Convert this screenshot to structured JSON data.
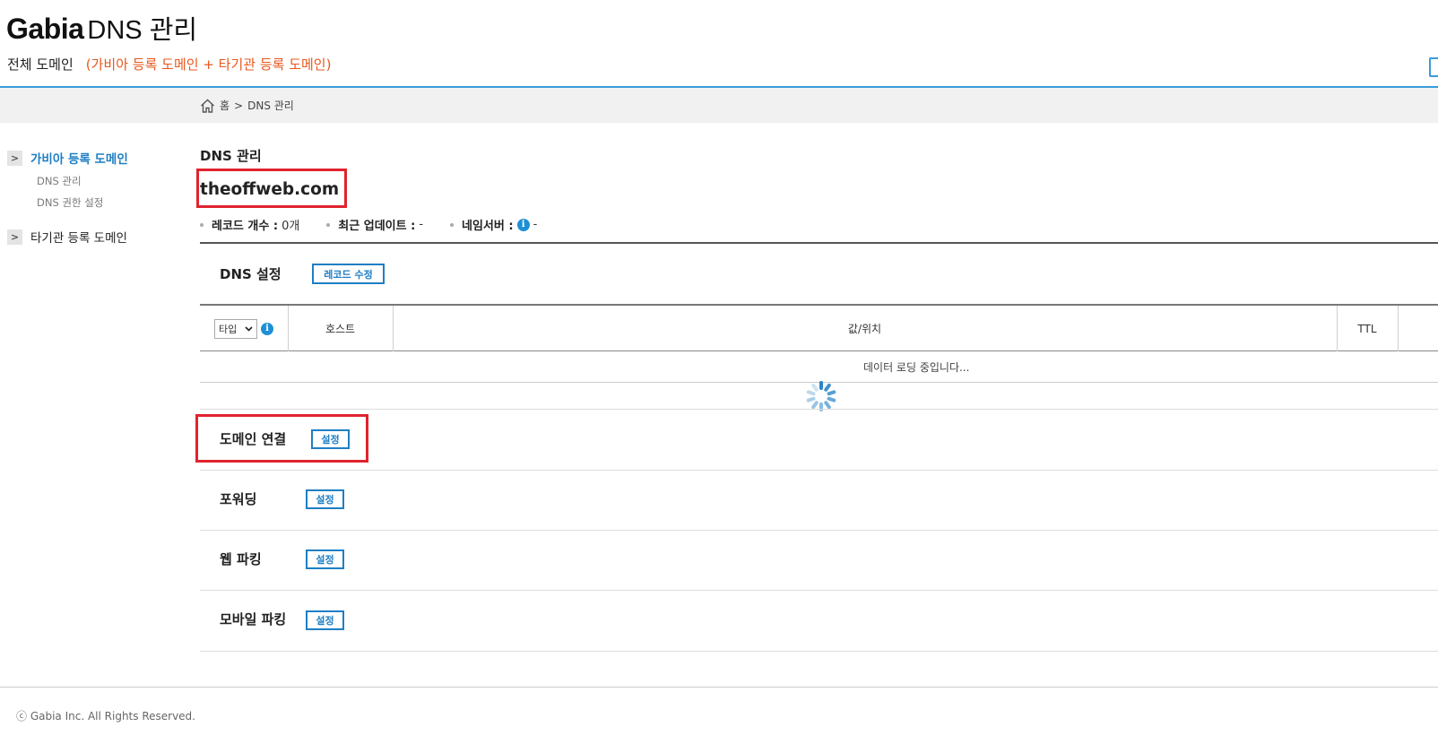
{
  "header": {
    "brand": "Gabia",
    "title": "DNS 관리",
    "subtitle_main": "전체 도메인",
    "subtitle_note": "(가비아 등록 도메인 + 타기관 등록 도메인)"
  },
  "breadcrumb": {
    "home": "홈",
    "separator": ">",
    "current": "DNS 관리"
  },
  "sidebar": {
    "groups": [
      {
        "label": "가비아 등록 도메인",
        "active": true,
        "items": [
          "DNS 관리",
          "DNS 권한 설정"
        ]
      },
      {
        "label": "타기관 등록 도메인",
        "active": false,
        "items": []
      }
    ],
    "arrow": ">"
  },
  "main": {
    "heading": "DNS 관리",
    "domain": "theoffweb.com",
    "meta": {
      "record_count_label": "레코드 개수 :",
      "record_count_value": "0개",
      "updated_label": "최근 업데이트 :",
      "updated_value": "-",
      "nameserver_label": "네임서버 :",
      "nameserver_value": "-"
    },
    "dns_settings": {
      "title": "DNS 설정",
      "edit_button": "레코드 수정",
      "columns": {
        "type": "타입",
        "host": "호스트",
        "value": "값/위치",
        "ttl": "TTL"
      },
      "loading_text": "데이터 로딩 중입니다..."
    },
    "sections": [
      {
        "title": "도메인 연결",
        "button": "설정"
      },
      {
        "title": "포워딩",
        "button": "설정"
      },
      {
        "title": "웹 파킹",
        "button": "설정"
      },
      {
        "title": "모바일 파킹",
        "button": "설정"
      }
    ]
  },
  "footer": {
    "copyright": "ⓒ Gabia Inc. All Rights Reserved."
  },
  "colors": {
    "accent": "#1e7fc4",
    "highlight": "#e0232e",
    "note": "#e8571e",
    "header_line": "#3a9ad9"
  }
}
